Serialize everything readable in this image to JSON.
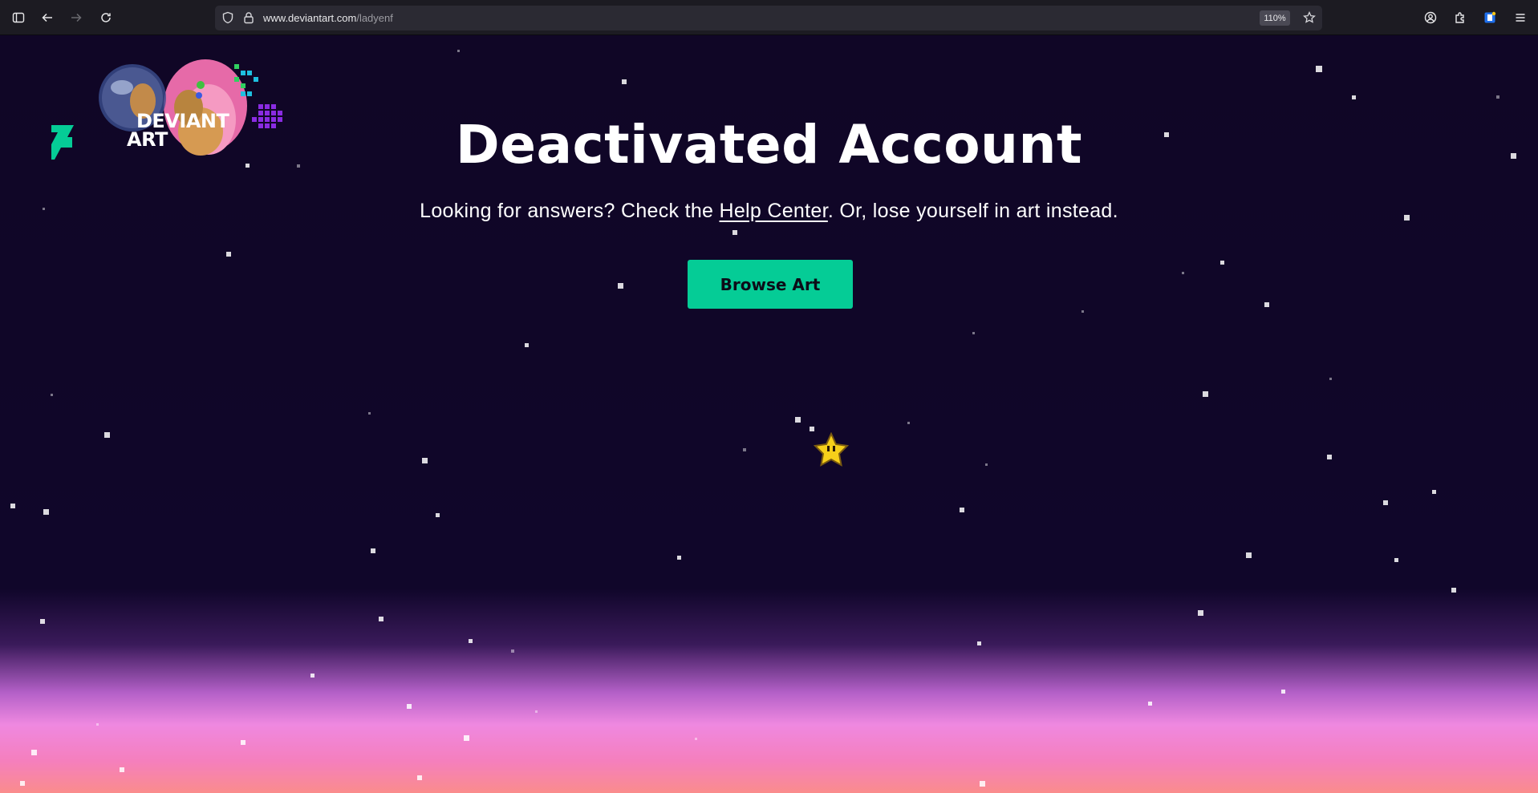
{
  "browser": {
    "url_host": "www.deviantart.com",
    "url_path": "/ladyenf",
    "zoom": "110%",
    "icons": [
      "sidebar-icon",
      "back-arrow-icon",
      "forward-arrow-icon",
      "reload-icon",
      "shield-icon",
      "lock-icon",
      "bookmark-star-icon",
      "account-icon",
      "extensions-icon",
      "extension-icon",
      "menu-icon"
    ]
  },
  "logo": {
    "line1": "DEVIANT",
    "line2": "ART",
    "mark_color": "#05cc96"
  },
  "main": {
    "headline": "Deactivated Account",
    "sub_prefix": "Looking for answers? Check the ",
    "help_link": "Help Center",
    "sub_suffix": ". Or, lose yourself in art instead.",
    "browse_button": "Browse Art"
  },
  "colors": {
    "background": "#100626",
    "accent": "#05cc96",
    "horizon_pink": "#ef88e0",
    "horizon_peach": "#fa8c8c"
  }
}
